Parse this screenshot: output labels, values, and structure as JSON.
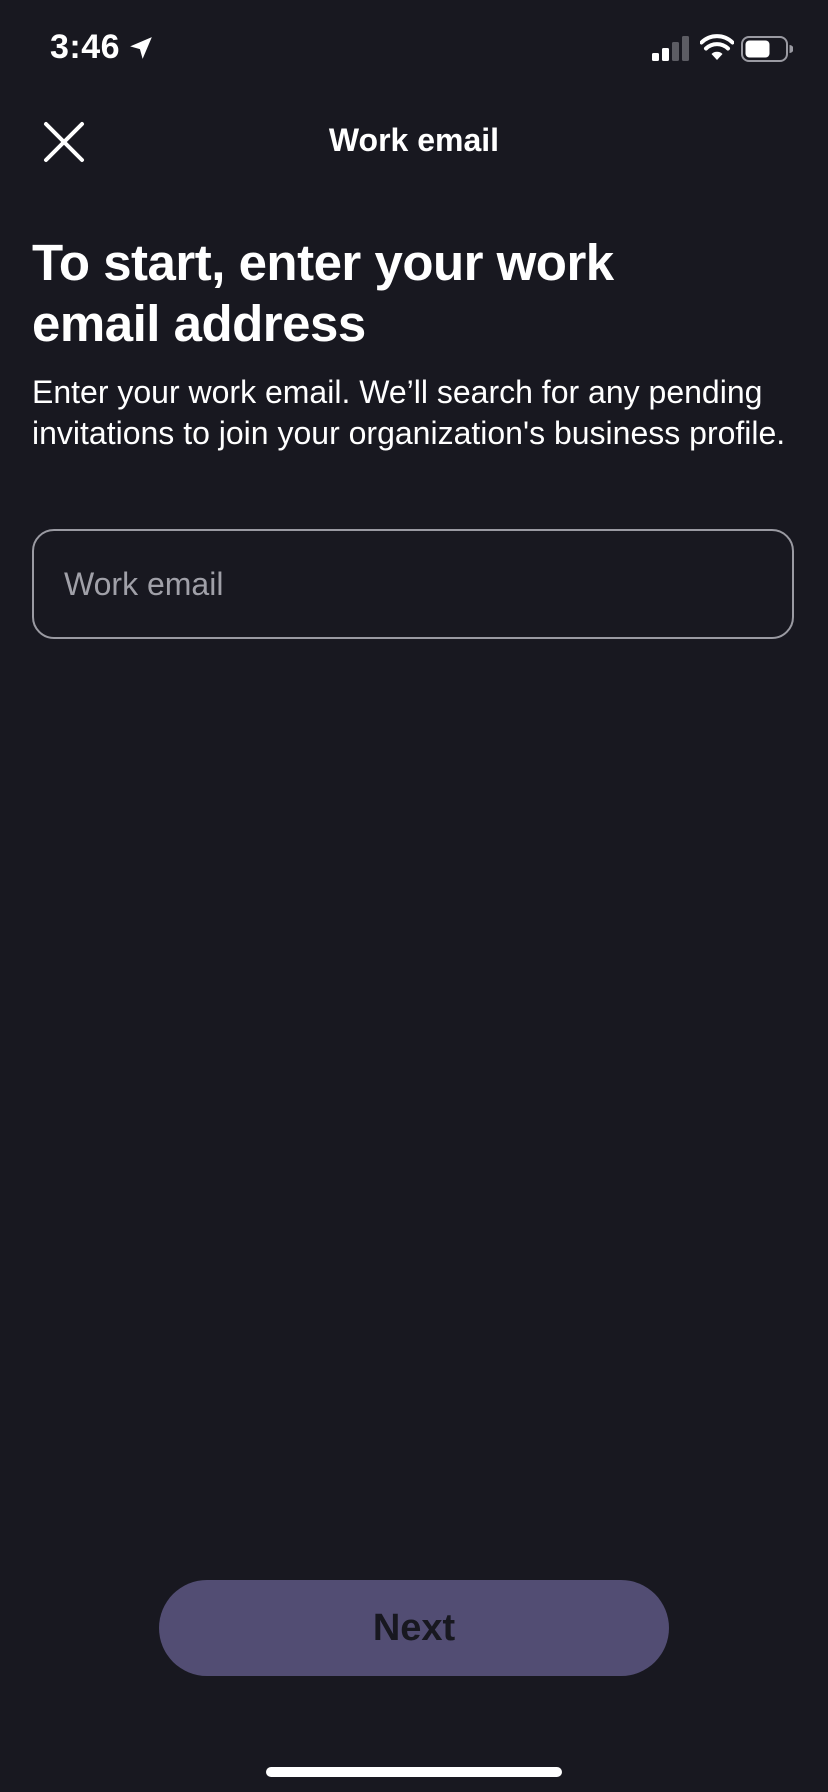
{
  "status_bar": {
    "time": "3:46"
  },
  "nav": {
    "title": "Work email",
    "close_icon": "close-icon"
  },
  "content": {
    "heading": "To start, enter your work email address",
    "description": "Enter your work email. We’ll search for any pending invitations to join your organization's business profile."
  },
  "email_input": {
    "placeholder": "Work email",
    "value": ""
  },
  "footer": {
    "next_label": "Next"
  },
  "colors": {
    "background": "#181820",
    "button": "#524d73",
    "input_border": "#9a9aa2"
  }
}
